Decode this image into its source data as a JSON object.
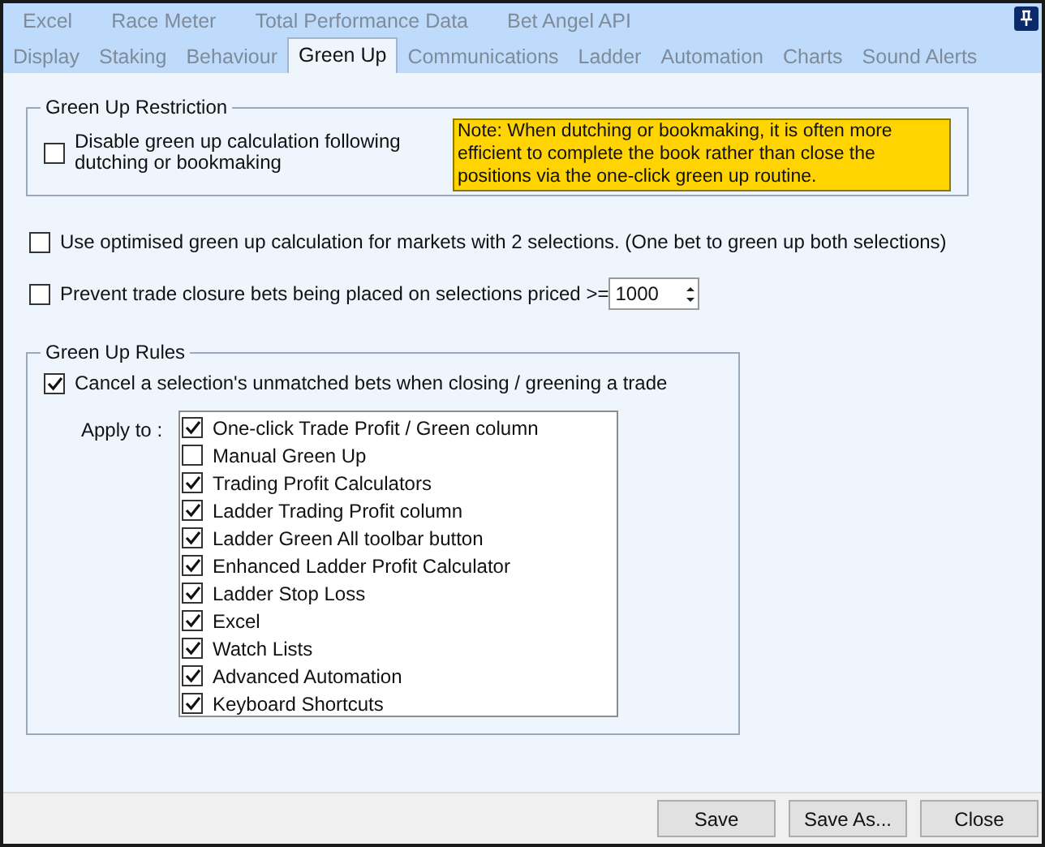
{
  "tabs_row_1": [
    {
      "label": "Excel",
      "selected": false
    },
    {
      "label": "Race Meter",
      "selected": false
    },
    {
      "label": "Total Performance Data",
      "selected": false
    },
    {
      "label": "Bet Angel API",
      "selected": false
    }
  ],
  "tabs_row_2": [
    {
      "label": "Display",
      "selected": false
    },
    {
      "label": "Staking",
      "selected": false
    },
    {
      "label": "Behaviour",
      "selected": false
    },
    {
      "label": "Green Up",
      "selected": true
    },
    {
      "label": "Communications",
      "selected": false
    },
    {
      "label": "Ladder",
      "selected": false
    },
    {
      "label": "Automation",
      "selected": false
    },
    {
      "label": "Charts",
      "selected": false
    },
    {
      "label": "Sound Alerts",
      "selected": false
    }
  ],
  "green_up_restriction": {
    "title": "Green Up Restriction",
    "option": {
      "label": "Disable green up calculation following dutching or bookmaking",
      "checked": false
    },
    "note": "Note: When dutching or bookmaking, it is often more efficient to complete the book rather than close the positions via the one-click green up routine."
  },
  "optimised_option": {
    "label": "Use optimised green up calculation for markets with 2 selections.  (One bet to green up both selections)",
    "checked": false
  },
  "prevent_option": {
    "label": "Prevent trade closure bets being placed on selections priced >=",
    "checked": false,
    "value": "1000"
  },
  "green_up_rules": {
    "title": "Green Up Rules",
    "cancel_option": {
      "label": "Cancel a selection's unmatched bets when closing / greening a trade",
      "checked": true
    },
    "apply_to_label": "Apply to :",
    "items": [
      {
        "label": "One-click Trade Profit / Green column",
        "checked": true
      },
      {
        "label": "Manual Green Up",
        "checked": false
      },
      {
        "label": "Trading Profit Calculators",
        "checked": true
      },
      {
        "label": "Ladder Trading Profit column",
        "checked": true
      },
      {
        "label": "Ladder Green All toolbar button",
        "checked": true
      },
      {
        "label": "Enhanced Ladder Profit Calculator",
        "checked": true
      },
      {
        "label": "Ladder Stop Loss",
        "checked": true
      },
      {
        "label": "Excel",
        "checked": true
      },
      {
        "label": "Watch Lists",
        "checked": true
      },
      {
        "label": "Advanced Automation",
        "checked": true
      },
      {
        "label": "Keyboard Shortcuts",
        "checked": true
      }
    ]
  },
  "buttons": [
    "Save",
    "Save As...",
    "Close"
  ]
}
